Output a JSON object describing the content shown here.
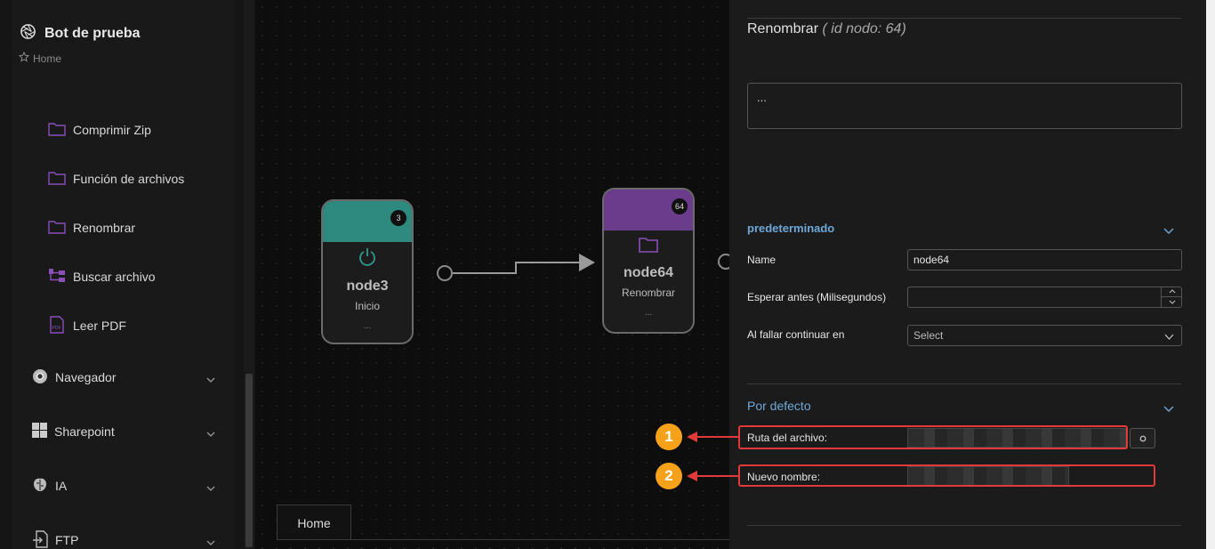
{
  "app": {
    "title": "Bot de prueba",
    "breadcrumb": "Home"
  },
  "sidebar": {
    "sub_items": [
      {
        "label": "Comprimir Zip",
        "icon": "folder-icon"
      },
      {
        "label": "Función de archivos",
        "icon": "folder-icon"
      },
      {
        "label": "Renombrar",
        "icon": "folder-icon"
      },
      {
        "label": "Buscar archivo",
        "icon": "file-tree-icon"
      },
      {
        "label": "Leer PDF",
        "icon": "pdf-icon"
      }
    ],
    "groups": [
      {
        "label": "Navegador",
        "icon": "chrome-icon"
      },
      {
        "label": "Sharepoint",
        "icon": "windows-icon"
      },
      {
        "label": "IA",
        "icon": "brain-icon"
      },
      {
        "label": "FTP",
        "icon": "file-transfer-icon"
      }
    ]
  },
  "canvas": {
    "nodes": [
      {
        "id": "3",
        "title": "node3",
        "subtitle": "Inicio",
        "dots": "...",
        "color": "#2e8a7e"
      },
      {
        "id": "64",
        "title": "node64",
        "subtitle": "Renombrar",
        "dots": "...",
        "color": "#6b3b8c"
      }
    ],
    "tab": "Home"
  },
  "panel": {
    "title": "Renombrar",
    "title_id": "( id nodo: 64)",
    "description": "...",
    "section1": {
      "title": "predeterminado",
      "name_label": "Name",
      "name_value": "node64",
      "wait_label": "Esperar antes (Milisegundos)",
      "wait_value": "",
      "fail_label": "Al fallar continuar en",
      "fail_value": "Select"
    },
    "section2": {
      "title": "Por defecto",
      "path_label": "Ruta del archivo:",
      "newname_label": "Nuevo nombre:"
    }
  },
  "annotations": {
    "one": "1",
    "two": "2",
    "color": "#e03a3a",
    "badge_color": "#f5a21a"
  },
  "colors": {
    "accent_blue": "#6ea8d8",
    "folder_purple": "#8a4fb8",
    "teal": "#2e8a7e"
  }
}
